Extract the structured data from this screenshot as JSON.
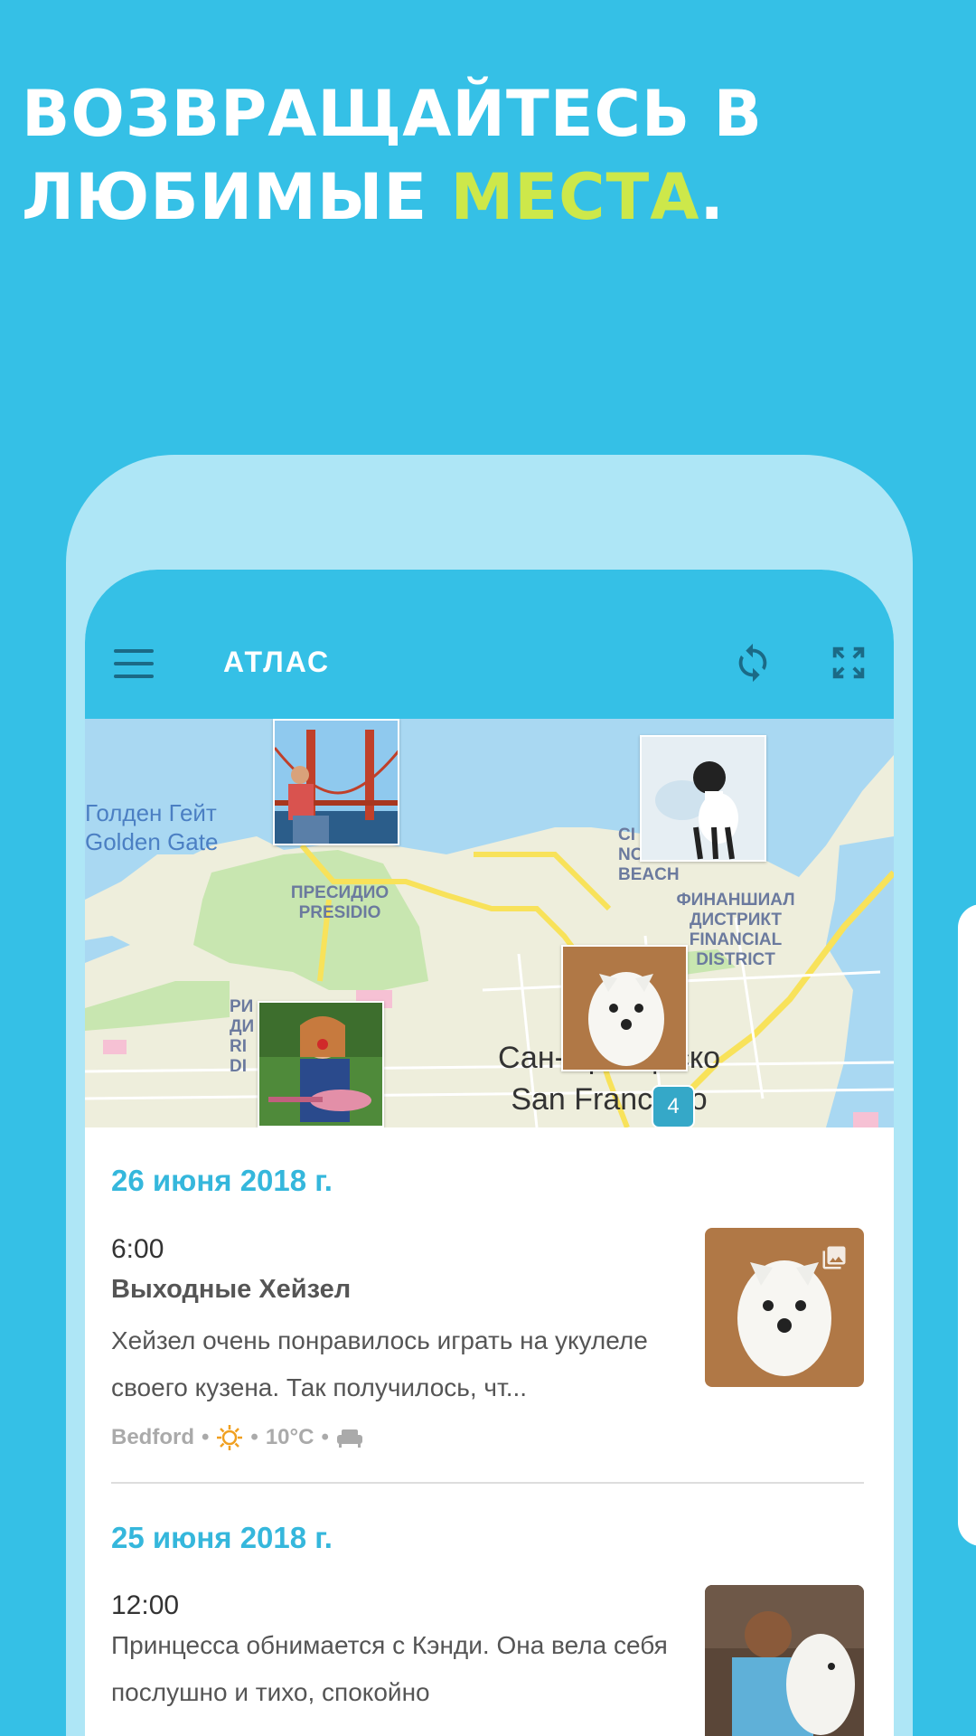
{
  "headline": {
    "line1": "ВОЗВРАЩАЙТЕСЬ В",
    "line2_prefix": "ЛЮБИМЫЕ ",
    "line2_accent": "МЕСТА",
    "line2_suffix": "."
  },
  "colors": {
    "background": "#35c0e6",
    "accent_word": "#cde84a",
    "date_text": "#35b7dc"
  },
  "app_bar": {
    "title": "АТЛАС",
    "menu_icon": "hamburger-menu-icon",
    "sync_icon": "sync-icon",
    "expand_icon": "fullscreen-icon"
  },
  "map": {
    "golden_gate_ru": "Голден Гейт",
    "golden_gate_en": "Golden Gate",
    "presidio_ru": "ПРЕСИДИО",
    "presidio_en": "PRESIDIO",
    "north_beach": "NORTH BEACH",
    "north_beach_partial": "СІ",
    "financial_ru_1": "ФИНАНШИАЛ",
    "financial_ru_2": "ДИСТРИКТ",
    "financial_en_1": "FINANCIAL",
    "financial_en_2": "DISTRICT",
    "richmond_partial": "РИ\nДИ\nRI\nDI",
    "city_ru": "Сан-Франциско",
    "city_en": "San Francisco",
    "cluster_count": "4"
  },
  "entries": [
    {
      "date": "26 июня 2018 г.",
      "time": "6:00",
      "title": "Выходные Хейзел",
      "text": "Хейзел очень понравилось играть на укулеле своего кузена. Так получилось, чт...",
      "location": "Bedford",
      "weather_icon": "sun-icon",
      "temperature": "10°C",
      "activity_icon": "sofa-icon",
      "separator": "•"
    },
    {
      "date": "25 июня 2018 г.",
      "time": "12:00",
      "title": "",
      "text": "Принцесса обнимается с Кэнди. Она вела себя послушно и тихо, спокойно"
    }
  ]
}
